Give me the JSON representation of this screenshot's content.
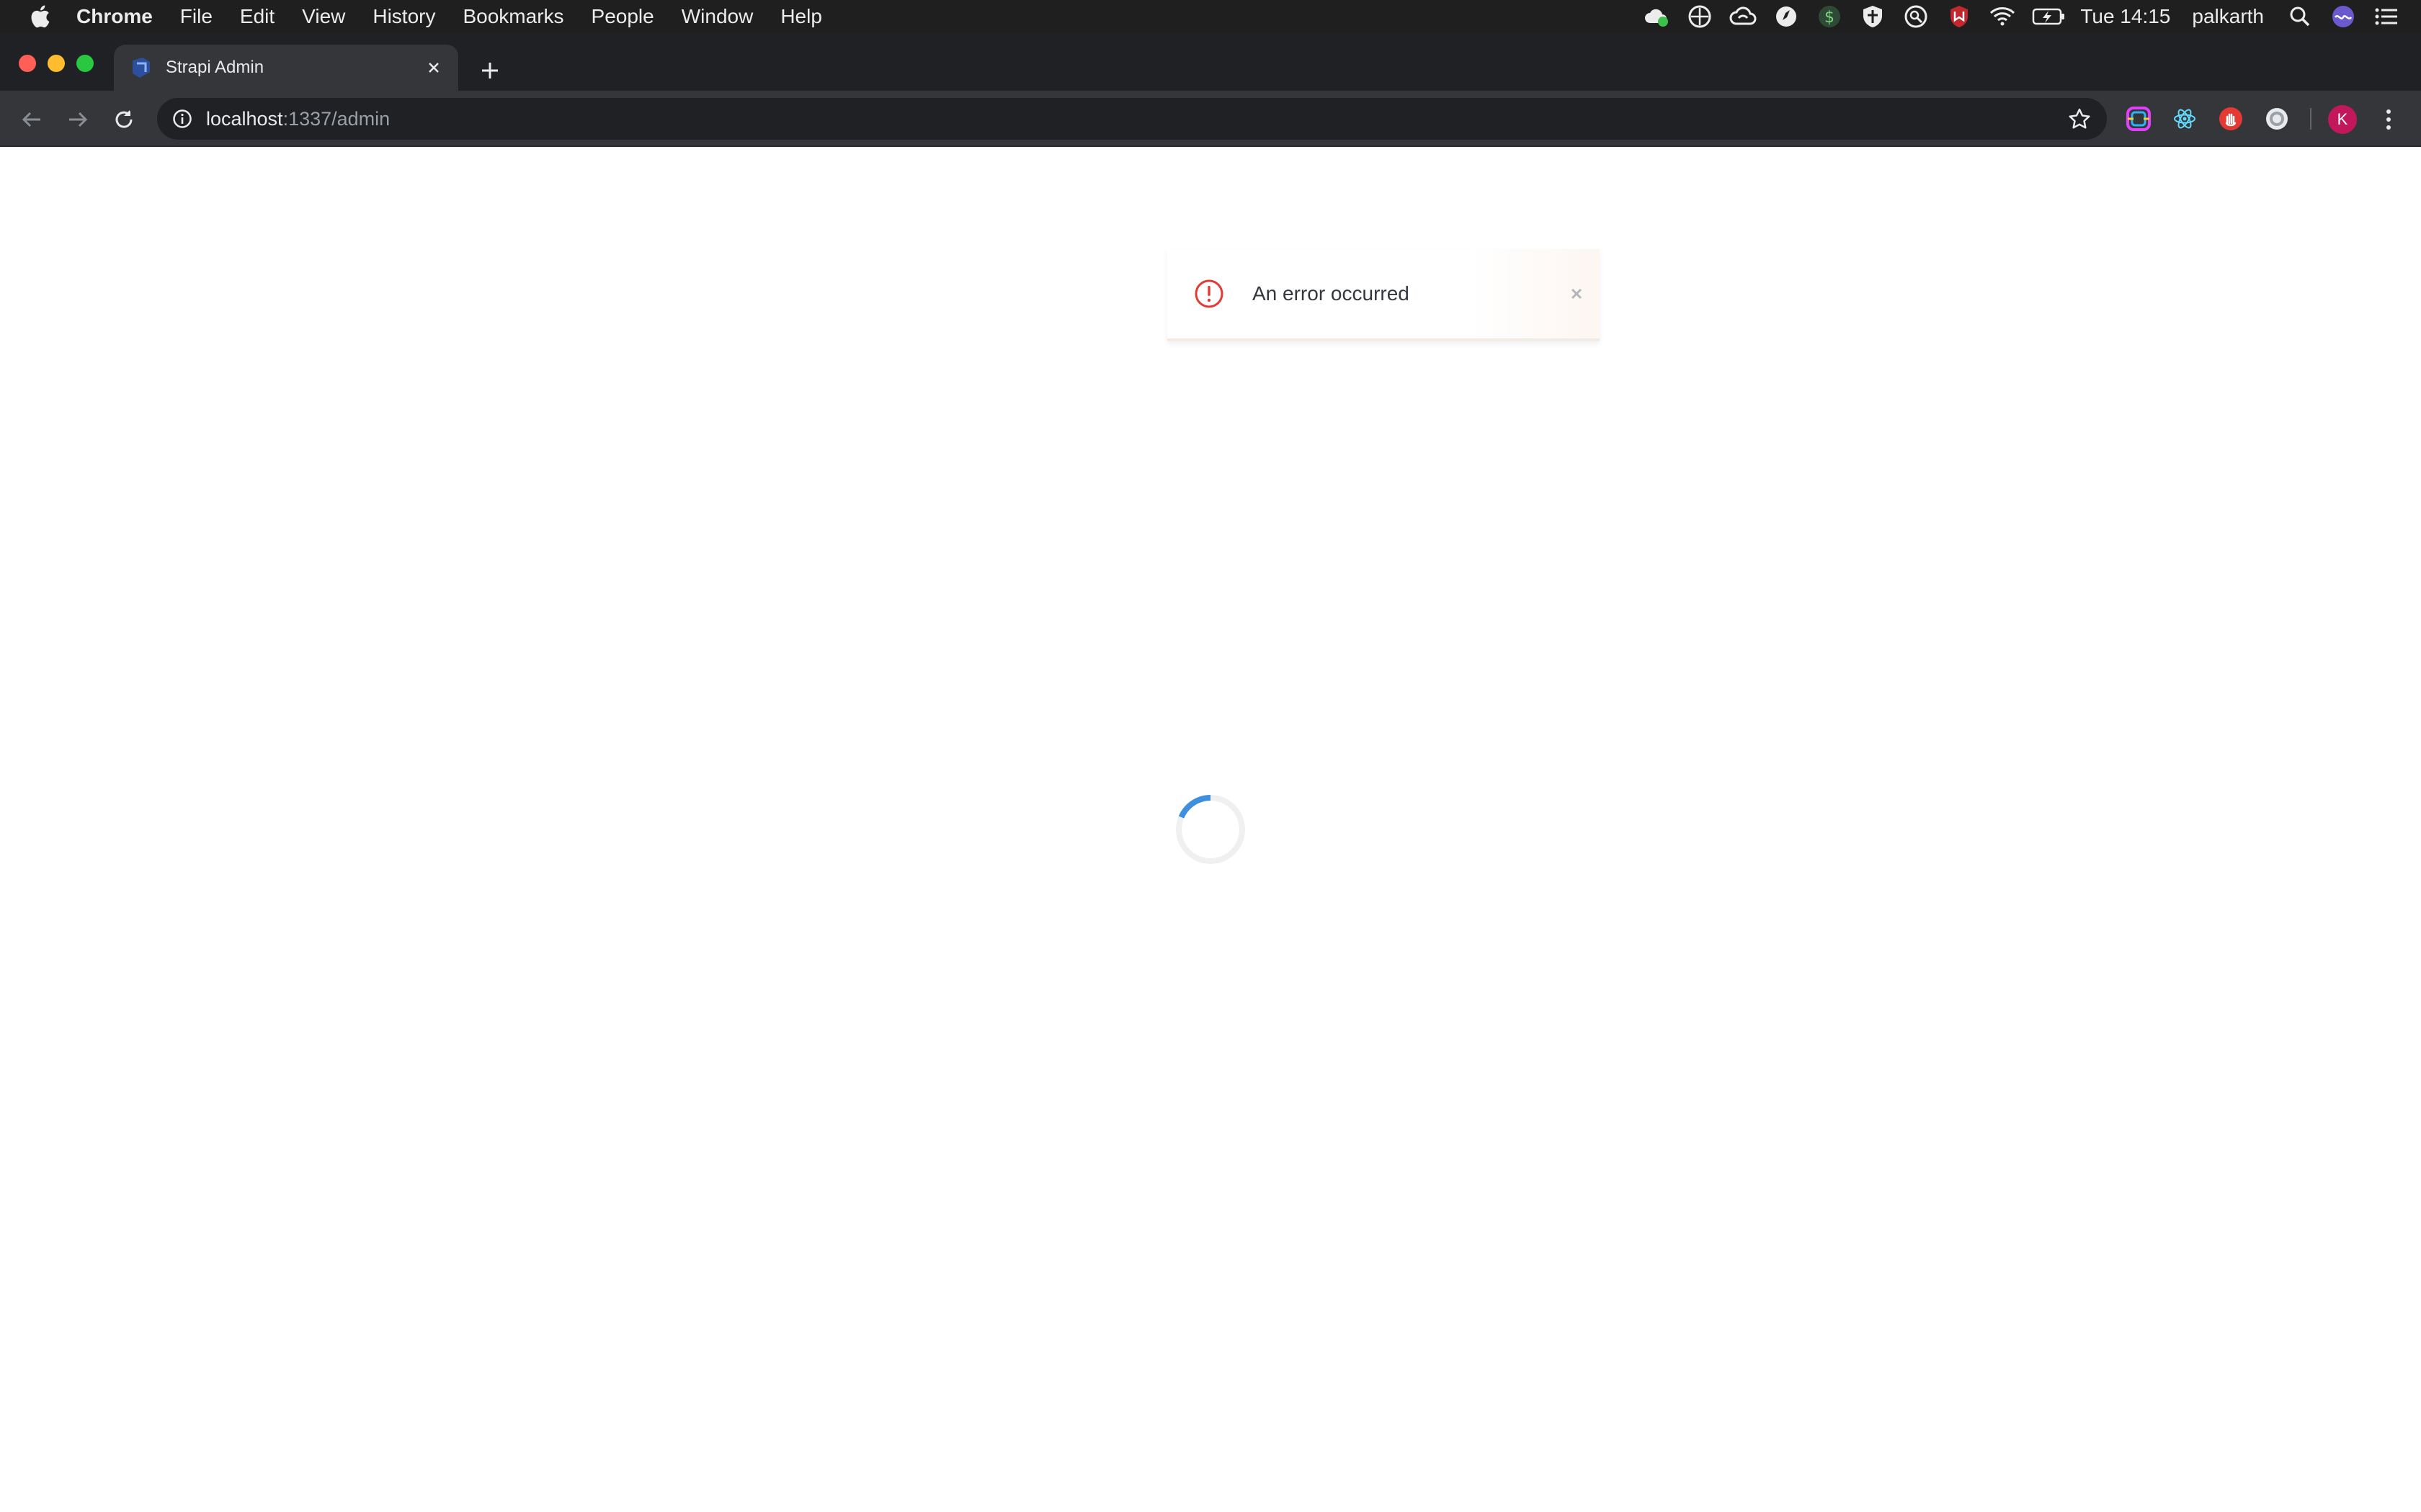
{
  "menubar": {
    "app_name": "Chrome",
    "items": [
      "File",
      "Edit",
      "View",
      "History",
      "Bookmarks",
      "People",
      "Window",
      "Help"
    ],
    "clock": "Tue 14:15",
    "user": "palkarth"
  },
  "browser": {
    "tab_title": "Strapi Admin",
    "url_host": "localhost",
    "url_path": ":1337/admin",
    "avatar_initial": "K"
  },
  "notification": {
    "message": "An error occurred",
    "type": "error",
    "accent_color": "#e53935"
  },
  "spinner": {
    "accent_color": "#3f8fdf"
  },
  "icons": {
    "status_bar": [
      "cloud-sync-icon",
      "globe-clock-icon",
      "creative-cloud-icon",
      "compass-icon",
      "dollar-icon",
      "shield-icon",
      "magnifier-tool-icon",
      "mcafee-icon",
      "wifi-icon",
      "battery-charging-icon",
      "spotlight-search-icon",
      "siri-icon",
      "notification-center-icon"
    ],
    "extensions": [
      "color-picker-extension-icon",
      "react-devtools-icon",
      "hand-stop-extension-icon",
      "circle-extension-icon"
    ]
  }
}
